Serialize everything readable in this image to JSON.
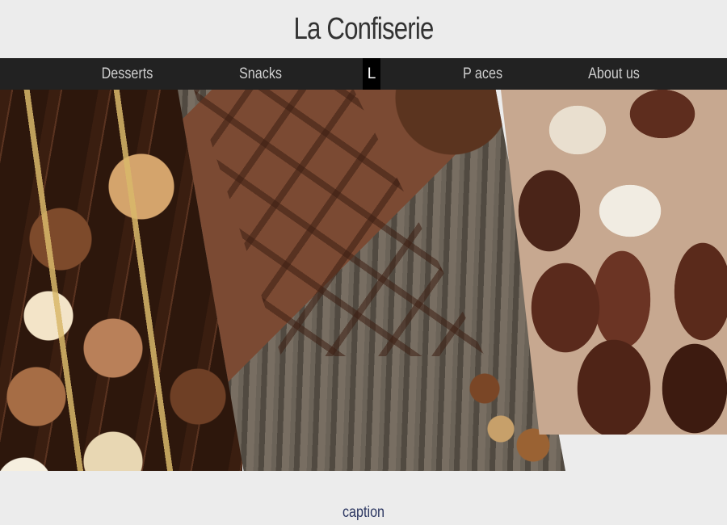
{
  "site": {
    "title": "La Confiserie"
  },
  "nav": {
    "items": [
      {
        "label": "Desserts"
      },
      {
        "label": "Snacks"
      },
      {
        "label": "L"
      },
      {
        "label": "P aces"
      },
      {
        "label": "About us"
      }
    ]
  },
  "gallery": {
    "caption": "caption",
    "photos": [
      {
        "subject": "assorted-pralines"
      },
      {
        "subject": "chocolate-bar-hazelnuts-cinnamon"
      },
      {
        "subject": "chocolate-truffles"
      }
    ]
  },
  "colors": {
    "page_background": "#ececec",
    "navbar_background": "#222222",
    "nav_text": "#cfcfcf",
    "title_text": "#333333",
    "caption_text": "#2a3560"
  }
}
